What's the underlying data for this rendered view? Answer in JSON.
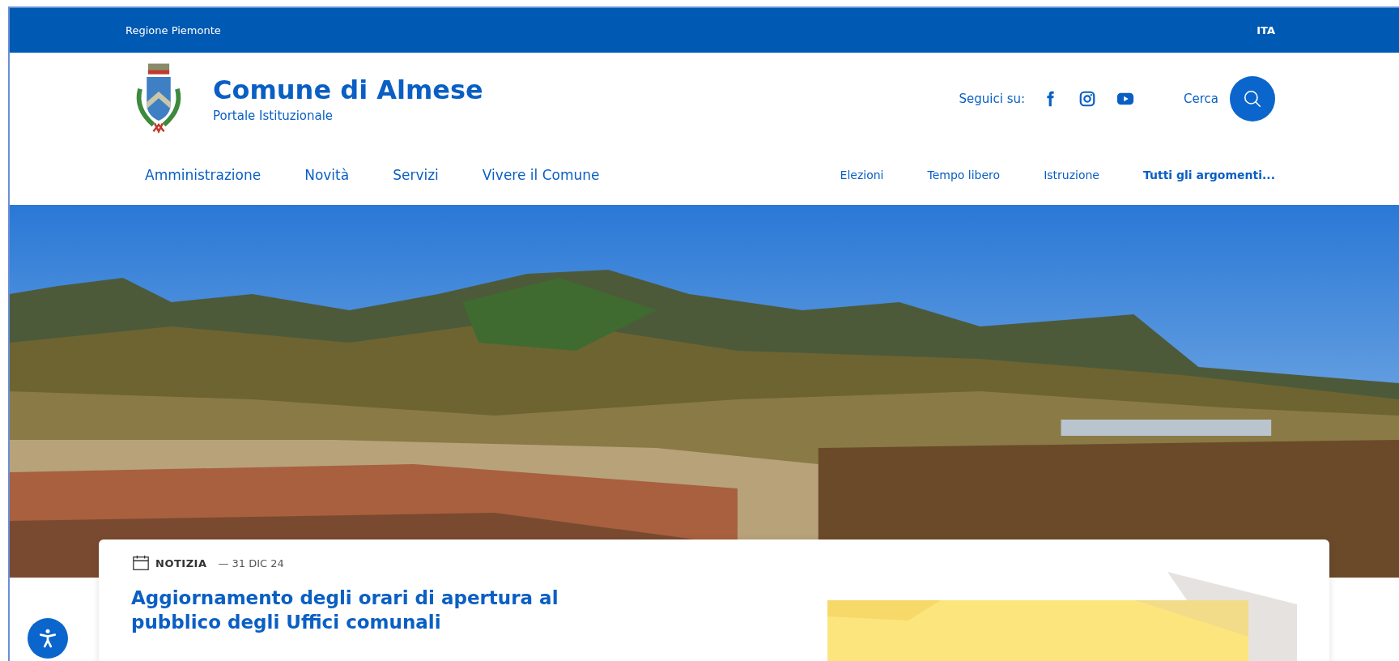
{
  "top_bar": {
    "region": "Regione Piemonte",
    "language": "ITA"
  },
  "header": {
    "title": "Comune di Almese",
    "subtitle": "Portale Istituzionale",
    "follow_label": "Seguici su:",
    "search_label": "Cerca"
  },
  "main_nav": [
    "Amministrazione",
    "Novità",
    "Servizi",
    "Vivere il Comune"
  ],
  "topics_nav": [
    {
      "label": "Elezioni",
      "bold": false
    },
    {
      "label": "Tempo libero",
      "bold": false
    },
    {
      "label": "Istruzione",
      "bold": false
    },
    {
      "label": "Tutti gli argomenti...",
      "bold": true
    }
  ],
  "news_card": {
    "category": "NOTIZIA",
    "date": "— 31 DIC 24",
    "title": "Aggiornamento degli orari di apertura al pubblico degli Uffici comunali"
  }
}
